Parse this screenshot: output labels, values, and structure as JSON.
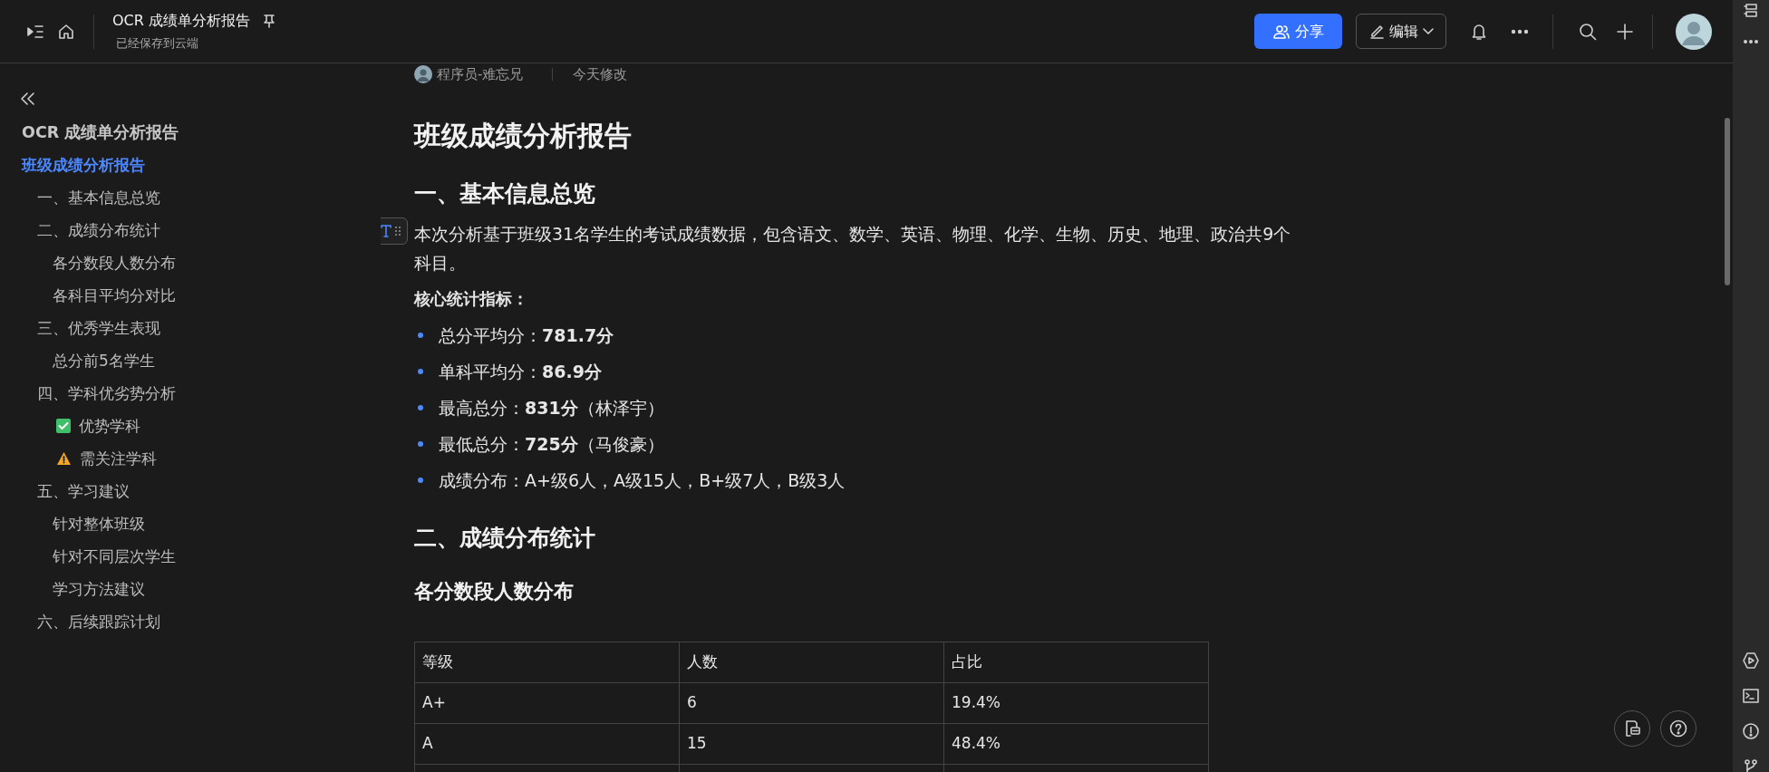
{
  "header": {
    "title": "OCR 成绩单分析报告",
    "save_status": "已经保存到云端",
    "share_button": "分享",
    "edit_button": "编辑"
  },
  "outline": {
    "doc_title": "OCR 成绩单分析报告",
    "items": [
      {
        "label": "班级成绩分析报告",
        "selected": true,
        "kind": "plain",
        "children": [
          {
            "label": "一、基本信息总览",
            "selected": false,
            "kind": "plain"
          },
          {
            "label": "二、成绩分布统计",
            "selected": false,
            "kind": "plain",
            "children": [
              {
                "label": "各分数段人数分布",
                "selected": false,
                "kind": "plain"
              },
              {
                "label": "各科目平均分对比",
                "selected": false,
                "kind": "plain"
              }
            ]
          },
          {
            "label": "三、优秀学生表现",
            "selected": false,
            "kind": "plain",
            "children": [
              {
                "label": "总分前5名学生",
                "selected": false,
                "kind": "plain"
              }
            ]
          },
          {
            "label": "四、学科优劣势分析",
            "selected": false,
            "kind": "plain",
            "children": [
              {
                "label": "优势学科",
                "selected": false,
                "kind": "check"
              },
              {
                "label": "需关注学科",
                "selected": false,
                "kind": "warning"
              }
            ]
          },
          {
            "label": "五、学习建议",
            "selected": false,
            "kind": "plain",
            "children": [
              {
                "label": "针对整体班级",
                "selected": false,
                "kind": "plain"
              },
              {
                "label": "针对不同层次学生",
                "selected": false,
                "kind": "plain"
              },
              {
                "label": "学习方法建议",
                "selected": false,
                "kind": "plain"
              }
            ]
          },
          {
            "label": "六、后续跟踪计划",
            "selected": false,
            "kind": "plain"
          }
        ]
      }
    ]
  },
  "document": {
    "author": "程序员-难忘兄",
    "modified": "今天修改",
    "title": "班级成绩分析报告",
    "blocks": [
      {
        "kind": "h2",
        "text": "一、基本信息总览"
      },
      {
        "kind": "paragraph",
        "text": "本次分析基于班级31名学生的考试成绩数据，包含语文、数学、英语、物理、化学、生物、历史、地理、政治共9个科目。"
      },
      {
        "kind": "label",
        "text": "核心统计指标："
      },
      {
        "kind": "bullets",
        "items": [
          "总分平均分：**781.7分**",
          "单科平均分：**86.9分**",
          "最高总分：**831分**（林泽宇）",
          "最低总分：**725分**（马俊豪）",
          "成绩分布：A+级6人，A级15人，B+级7人，B级3人"
        ]
      },
      {
        "kind": "h2",
        "text": "二、成绩分布统计"
      },
      {
        "kind": "h3",
        "text": "各分数段人数分布"
      },
      {
        "kind": "table",
        "columns": [
          "等级",
          "人数",
          "占比"
        ],
        "rows": [
          [
            "A+",
            "6",
            "19.4%"
          ],
          [
            "A",
            "15",
            "48.4%"
          ]
        ]
      }
    ]
  }
}
